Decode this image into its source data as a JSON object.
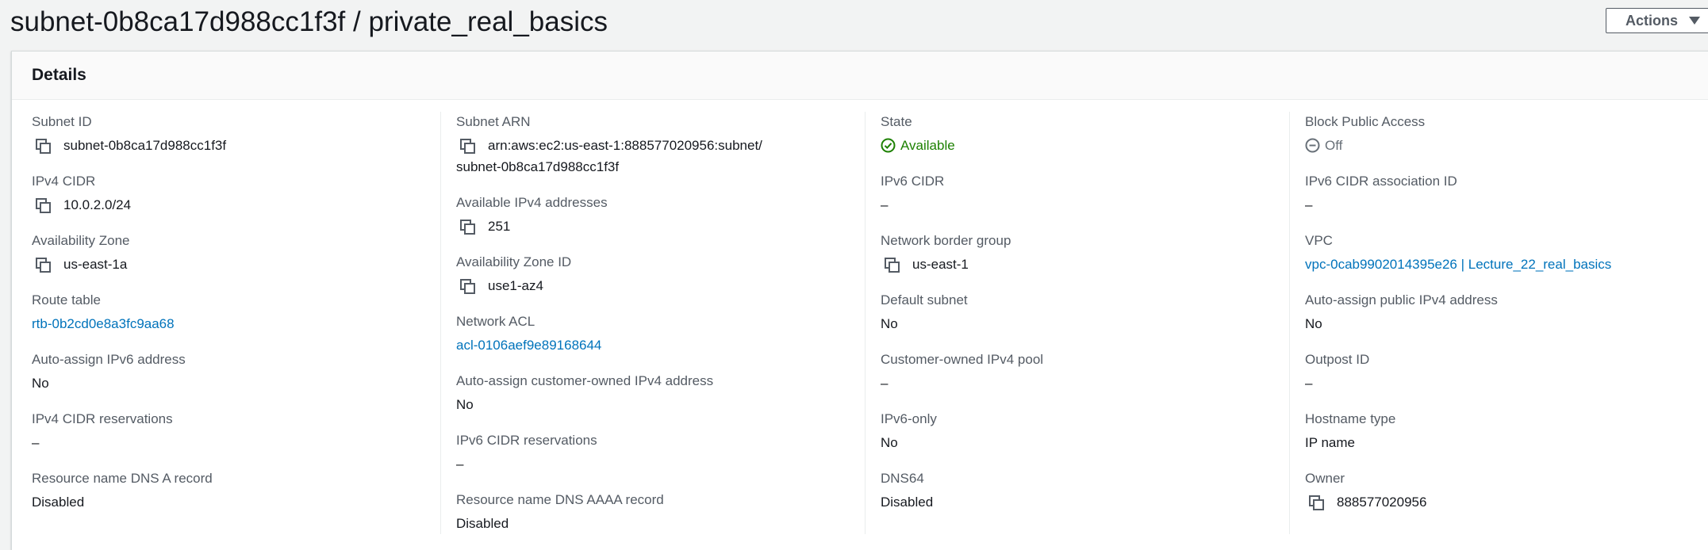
{
  "page": {
    "title": "subnet-0b8ca17d988cc1f3f / private_real_basics",
    "actions_label": "Actions"
  },
  "panel": {
    "title": "Details"
  },
  "col1": {
    "subnet_id_label": "Subnet ID",
    "subnet_id_value": "subnet-0b8ca17d988cc1f3f",
    "ipv4_cidr_label": "IPv4 CIDR",
    "ipv4_cidr_value": "10.0.2.0/24",
    "az_label": "Availability Zone",
    "az_value": "us-east-1a",
    "route_table_label": "Route table",
    "route_table_value": "rtb-0b2cd0e8a3fc9aa68",
    "auto_ipv6_label": "Auto-assign IPv6 address",
    "auto_ipv6_value": "No",
    "ipv4_res_label": "IPv4 CIDR reservations",
    "ipv4_res_value": "–",
    "dns_a_label": "Resource name DNS A record",
    "dns_a_value": "Disabled"
  },
  "col2": {
    "subnet_arn_label": "Subnet ARN",
    "subnet_arn_line1": "arn:aws:ec2:us-east-1:888577020956:subnet/",
    "subnet_arn_line2": "subnet-0b8ca17d988cc1f3f",
    "avail_ipv4_label": "Available IPv4 addresses",
    "avail_ipv4_value": "251",
    "az_id_label": "Availability Zone ID",
    "az_id_value": "use1-az4",
    "nacl_label": "Network ACL",
    "nacl_value": "acl-0106aef9e89168644",
    "auto_coip_label": "Auto-assign customer-owned IPv4 address",
    "auto_coip_value": "No",
    "ipv6_res_label": "IPv6 CIDR reservations",
    "ipv6_res_value": "–",
    "dns_aaaa_label": "Resource name DNS AAAA record",
    "dns_aaaa_value": "Disabled"
  },
  "col3": {
    "state_label": "State",
    "state_value": "Available",
    "ipv6_cidr_label": "IPv6 CIDR",
    "ipv6_cidr_value": "–",
    "nbg_label": "Network border group",
    "nbg_value": "us-east-1",
    "default_subnet_label": "Default subnet",
    "default_subnet_value": "No",
    "coip_pool_label": "Customer-owned IPv4 pool",
    "coip_pool_value": "–",
    "ipv6_only_label": "IPv6-only",
    "ipv6_only_value": "No",
    "dns64_label": "DNS64",
    "dns64_value": "Disabled"
  },
  "col4": {
    "bpa_label": "Block Public Access",
    "bpa_value": "Off",
    "ipv6_assoc_label": "IPv6 CIDR association ID",
    "ipv6_assoc_value": "–",
    "vpc_label": "VPC",
    "vpc_value": "vpc-0cab9902014395e26 | Lecture_22_real_basics",
    "auto_pub_ipv4_label": "Auto-assign public IPv4 address",
    "auto_pub_ipv4_value": "No",
    "outpost_label": "Outpost ID",
    "outpost_value": "–",
    "hostname_label": "Hostname type",
    "hostname_value": "IP name",
    "owner_label": "Owner",
    "owner_value": "888577020956"
  },
  "colors": {
    "link": "#0073bb",
    "success": "#1d8102",
    "muted": "#687078",
    "label": "#545b64"
  },
  "icons": {
    "copy": "copy-icon",
    "available": "status-available-icon",
    "off": "status-off-icon",
    "caret": "caret-down-icon"
  }
}
